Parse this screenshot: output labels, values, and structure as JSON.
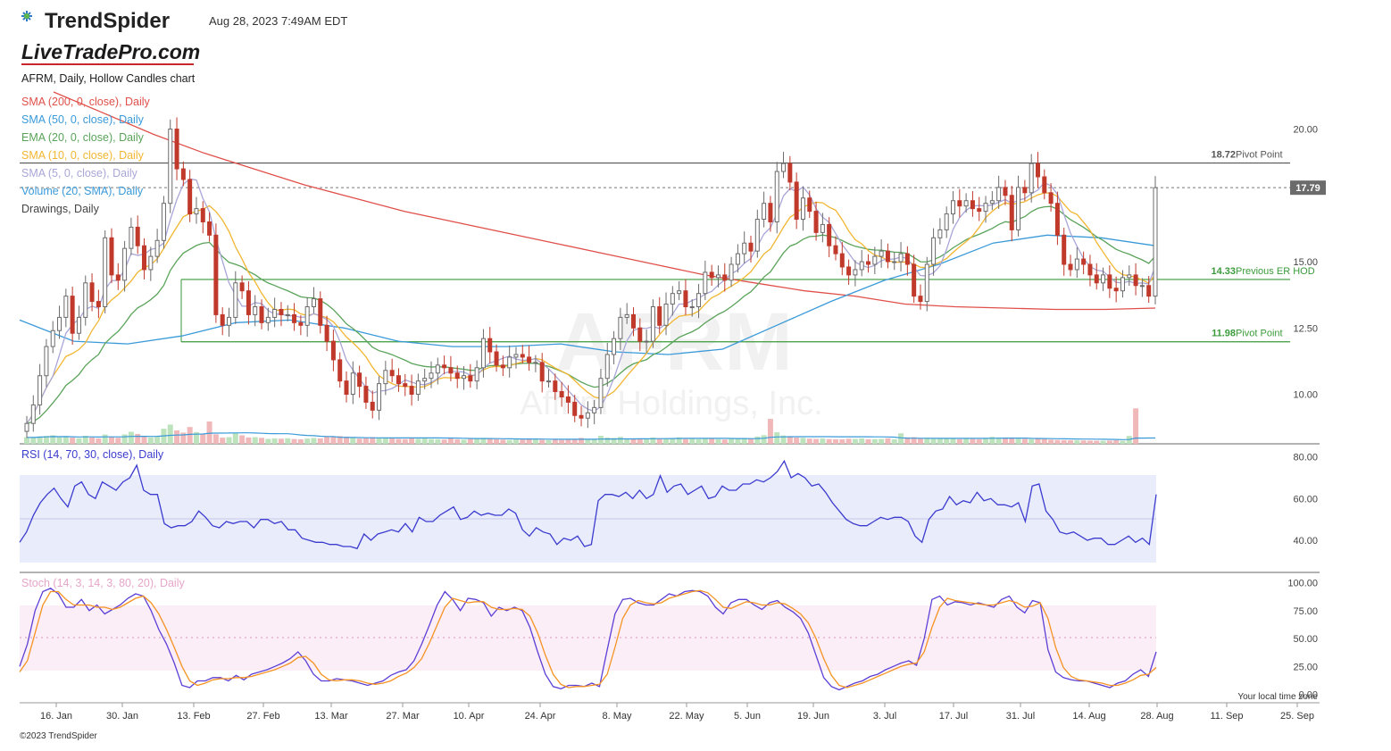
{
  "header": {
    "brand_name": "TrendSpider",
    "timestamp": "Aug 28, 2023 7:49AM EDT",
    "watermark_logo": "LiveTradePro.com",
    "footer": "©2023 TrendSpider",
    "tz_note": "Your local time zone"
  },
  "legend": {
    "title": "AFRM, Daily, Hollow Candles chart",
    "items": [
      {
        "label": "SMA (200, 0, close), Daily",
        "color": "#e0504a"
      },
      {
        "label": "SMA (50, 0, close), Daily",
        "color": "#3a9ad9"
      },
      {
        "label": "EMA (20, 0, close), Daily",
        "color": "#5aa35a"
      },
      {
        "label": "SMA (10, 0, close), Daily",
        "color": "#f2b632"
      },
      {
        "label": "SMA (5, 0, close), Daily",
        "color": "#a9a6d8"
      },
      {
        "label": "Volume (20, SMA), Daily",
        "color": "#3a9ad9"
      },
      {
        "label": "Drawings, Daily",
        "color": "#444444"
      }
    ]
  },
  "watermark": {
    "symbol": "AFRM",
    "company": "Affirm Holdings, Inc."
  },
  "chart_data": [
    {
      "type": "candlestick",
      "title": "AFRM, Daily, Hollow Candles chart",
      "ylim": [
        8.3,
        21.5
      ],
      "yticks": [
        20.0,
        15.0,
        12.5,
        10.0
      ],
      "ytick_labels": [
        "20.00",
        "15.00",
        "12.50",
        "10.00"
      ],
      "xticks": [
        "16. Jan",
        "30. Jan",
        "13. Feb",
        "27. Feb",
        "13. Mar",
        "27. Mar",
        "10. Apr",
        "24. Apr",
        "8. May",
        "22. May",
        "5. Jun",
        "19. Jun",
        "3. Jul",
        "17. Jul",
        "31. Jul",
        "14. Aug",
        "28. Aug",
        "11. Sep",
        "25. Sep"
      ],
      "last_price": "17.79",
      "levels": [
        {
          "value": 18.72,
          "value_label": "18.72",
          "text": "Pivot Point",
          "color": "#555555"
        },
        {
          "value": 14.33,
          "value_label": "14.33",
          "text": "Previous ER HOD",
          "color": "#3a9a3a"
        },
        {
          "value": 11.98,
          "value_label": "11.98",
          "text": "Pivot Point",
          "color": "#3a9a3a"
        }
      ],
      "close": [
        8.9,
        9.6,
        10.7,
        11.8,
        12.4,
        12.9,
        13.7,
        12.3,
        12.9,
        14.2,
        13.5,
        13.3,
        15.9,
        14.5,
        14.3,
        15.5,
        16.3,
        15.6,
        14.7,
        15.2,
        15.8,
        17.2,
        20.0,
        18.5,
        18.1,
        16.8,
        17.0,
        16.5,
        16.0,
        13.0,
        12.6,
        12.9,
        14.2,
        13.9,
        13.0,
        13.3,
        12.7,
        12.9,
        13.2,
        13.0,
        13.0,
        12.7,
        12.6,
        13.3,
        13.6,
        12.6,
        12.0,
        11.3,
        10.5,
        10.0,
        10.8,
        10.3,
        9.7,
        9.4,
        10.4,
        10.9,
        10.7,
        10.4,
        10.3,
        10.0,
        10.5,
        10.6,
        10.8,
        11.1,
        11.0,
        10.8,
        10.6,
        10.7,
        10.5,
        11.0,
        12.1,
        11.6,
        11.1,
        11.0,
        11.4,
        11.5,
        11.4,
        11.2,
        11.2,
        10.5,
        10.5,
        10.1,
        9.9,
        9.7,
        9.2,
        9.1,
        9.3,
        9.5,
        10.6,
        11.5,
        12.1,
        12.9,
        13.0,
        12.5,
        12.0,
        12.0,
        13.3,
        12.6,
        13.4,
        13.8,
        13.9,
        13.3,
        13.3,
        13.8,
        14.6,
        14.4,
        14.5,
        14.3,
        14.9,
        15.3,
        15.7,
        15.4,
        16.6,
        17.2,
        16.5,
        18.4,
        18.7,
        18.0,
        16.6,
        17.4,
        16.9,
        16.1,
        16.4,
        15.6,
        15.3,
        14.8,
        14.5,
        14.7,
        15.0,
        14.9,
        15.2,
        15.4,
        15.0,
        15.0,
        15.3,
        14.9,
        13.7,
        13.5,
        14.9,
        15.9,
        16.2,
        16.8,
        17.3,
        17.1,
        17.3,
        17.0,
        16.9,
        17.2,
        17.3,
        17.8,
        17.5,
        16.2,
        17.8,
        17.6,
        18.7,
        18.2,
        17.6,
        17.2,
        16.0,
        14.9,
        14.7,
        15.1,
        14.9,
        14.5,
        14.2,
        14.5,
        14.0,
        13.9,
        14.4,
        14.5,
        14.1,
        14.1,
        13.7,
        17.79
      ],
      "volume_ylim": [
        0,
        40
      ],
      "volume": [
        4.2,
        4.0,
        4.8,
        5.1,
        5.5,
        4.3,
        4.8,
        4.0,
        3.6,
        5.2,
        4.1,
        3.5,
        6.0,
        4.5,
        3.9,
        6.1,
        7.8,
        6.4,
        4.8,
        4.2,
        4.5,
        9.8,
        12.5,
        8.7,
        7.3,
        10.9,
        7.6,
        6.2,
        14.5,
        6.2,
        4.0,
        4.3,
        7.2,
        5.5,
        4.1,
        4.3,
        3.9,
        3.2,
        3.5,
        3.3,
        3.6,
        3.1,
        2.9,
        3.4,
        3.8,
        3.5,
        4.6,
        4.9,
        5.0,
        4.6,
        3.8,
        3.4,
        4.0,
        4.3,
        4.1,
        3.9,
        3.5,
        3.2,
        3.1,
        3.6,
        3.3,
        3.9,
        3.1,
        3.0,
        2.8,
        3.5,
        2.9,
        2.7,
        3.1,
        3.4,
        3.9,
        3.5,
        3.0,
        2.7,
        2.5,
        2.8,
        2.7,
        3.0,
        2.8,
        2.6,
        2.4,
        2.8,
        2.5,
        3.0,
        3.2,
        3.8,
        2.8,
        3.1,
        5.2,
        4.1,
        3.8,
        4.5,
        3.4,
        3.0,
        3.2,
        2.9,
        4.1,
        3.5,
        3.3,
        3.6,
        4.2,
        3.1,
        3.4,
        3.0,
        3.7,
        3.3,
        3.0,
        2.8,
        3.5,
        3.6,
        3.8,
        3.2,
        4.7,
        5.6,
        16.2,
        7.5,
        5.4,
        5.0,
        4.1,
        3.9,
        3.4,
        3.2,
        3.5,
        3.1,
        3.0,
        2.9,
        3.3,
        3.2,
        3.5,
        3.0,
        3.1,
        3.2,
        3.6,
        3.0,
        6.8,
        4.2,
        4.3,
        3.6,
        4.0,
        3.1,
        3.5,
        3.3,
        3.4,
        3.0,
        3.2,
        3.1,
        3.0,
        3.4,
        4.5,
        3.9,
        3.6,
        3.8,
        3.3,
        3.2,
        3.0,
        3.4,
        3.1,
        2.7,
        2.5,
        2.4,
        2.3,
        2.3,
        2.2,
        2.1,
        2.0,
        2.0,
        2.1,
        2.3,
        2.0,
        5.1,
        23.0
      ],
      "series": [
        {
          "name": "SMA (200, 0, close), Daily",
          "color": "#e0504a",
          "values": [
            21.4,
            20.6,
            19.8,
            19.1,
            18.5,
            17.9,
            17.4,
            16.9,
            16.5,
            16.1,
            15.7,
            15.3,
            14.9,
            14.5,
            14.2,
            13.9,
            13.7,
            13.4,
            13.3,
            13.25,
            13.2,
            13.2,
            13.25
          ]
        },
        {
          "name": "SMA (50, 0, close), Daily",
          "color": "#3a9ad9",
          "values": [
            12.8,
            12.0,
            11.9,
            12.2,
            12.7,
            12.8,
            12.5,
            12.0,
            11.8,
            11.8,
            11.9,
            11.6,
            11.5,
            11.7,
            12.6,
            13.5,
            14.3,
            14.9,
            15.7,
            16.0,
            15.9,
            15.6
          ]
        }
      ],
      "grid": true
    },
    {
      "type": "line",
      "title": "RSI (14, 70, 30, close), Daily",
      "ylim": [
        28,
        82
      ],
      "yticks": [
        80,
        60,
        40
      ],
      "ytick_labels": [
        "80.00",
        "60.00",
        "40.00"
      ],
      "band": [
        30,
        70
      ],
      "series": [
        {
          "name": "RSI (14, 70, 30, close), Daily",
          "color": "#3b3bcf",
          "values": [
            39,
            44,
            52,
            58,
            62,
            65,
            60,
            56,
            66,
            68,
            62,
            60,
            68,
            66,
            64,
            68,
            70,
            76,
            64,
            62,
            62,
            48,
            46,
            47,
            47,
            49,
            54,
            51,
            47,
            46,
            49,
            48,
            49,
            49,
            46,
            50,
            50,
            48,
            49,
            45,
            45,
            41,
            40,
            39,
            39,
            38,
            38,
            37,
            37,
            36,
            43,
            40,
            43,
            44,
            45,
            44,
            48,
            44,
            51,
            49,
            49,
            52,
            54,
            56,
            50,
            51,
            54,
            52,
            53,
            52,
            52,
            55,
            53,
            45,
            42,
            46,
            44,
            43,
            38,
            41,
            40,
            42,
            37,
            38,
            59,
            62,
            62,
            61,
            63,
            60,
            64,
            60,
            62,
            71,
            63,
            66,
            67,
            62,
            64,
            66,
            60,
            61,
            66,
            64,
            64,
            67,
            67,
            69,
            68,
            70,
            73,
            78,
            70,
            72,
            70,
            66,
            67,
            63,
            58,
            54,
            50,
            48,
            47,
            47,
            49,
            51,
            50,
            51,
            51,
            49,
            42,
            39,
            50,
            54,
            55,
            61,
            57,
            59,
            58,
            63,
            59,
            60,
            57,
            57,
            56,
            58,
            49,
            66,
            67,
            54,
            50,
            44,
            43,
            44,
            42,
            40,
            41,
            41,
            38,
            38,
            40,
            42,
            39,
            41,
            38,
            62
          ]
        }
      ]
    },
    {
      "type": "line",
      "title": "Stoch (14, 3, 14, 3, 80, 20), Daily",
      "ylim": [
        -2,
        102
      ],
      "yticks": [
        100,
        75,
        50,
        25,
        0
      ],
      "ytick_labels": [
        "100.00",
        "75.00",
        "50.00",
        "25.00",
        "0.00"
      ],
      "band": [
        20,
        80
      ],
      "midline": 50,
      "series": [
        {
          "name": "%K",
          "color": "#5c3fd6",
          "values": [
            25,
            45,
            75,
            92,
            95,
            90,
            78,
            78,
            85,
            75,
            80,
            72,
            76,
            80,
            86,
            90,
            88,
            75,
            58,
            45,
            28,
            8,
            6,
            12,
            12,
            15,
            15,
            12,
            17,
            13,
            18,
            20,
            22,
            25,
            28,
            32,
            38,
            30,
            18,
            12,
            12,
            14,
            13,
            12,
            10,
            8,
            10,
            12,
            17,
            20,
            22,
            30,
            45,
            62,
            80,
            92,
            85,
            75,
            86,
            85,
            82,
            70,
            78,
            75,
            78,
            75,
            60,
            38,
            18,
            7,
            5,
            8,
            8,
            7,
            10,
            7,
            40,
            72,
            85,
            86,
            82,
            80,
            80,
            85,
            90,
            88,
            92,
            93,
            92,
            88,
            78,
            72,
            82,
            85,
            85,
            80,
            76,
            82,
            84,
            78,
            74,
            68,
            55,
            35,
            15,
            7,
            4,
            7,
            10,
            12,
            16,
            18,
            22,
            25,
            28,
            30,
            26,
            50,
            85,
            88,
            80,
            83,
            82,
            80,
            82,
            80,
            78,
            85,
            88,
            78,
            73,
            84,
            82,
            40,
            20,
            15,
            13,
            12,
            12,
            10,
            8,
            6,
            10,
            12,
            18,
            22,
            16,
            38
          ]
        },
        {
          "name": "%D",
          "color": "#f59323",
          "values": [
            20,
            30,
            55,
            80,
            92,
            92,
            85,
            80,
            80,
            80,
            78,
            78,
            76,
            78,
            82,
            86,
            88,
            82,
            72,
            58,
            42,
            25,
            12,
            8,
            10,
            13,
            14,
            14,
            15,
            15,
            16,
            18,
            20,
            22,
            25,
            28,
            33,
            34,
            28,
            18,
            13,
            12,
            13,
            13,
            12,
            10,
            9,
            10,
            12,
            16,
            19,
            24,
            32,
            46,
            62,
            78,
            86,
            84,
            82,
            83,
            83,
            78,
            76,
            76,
            77,
            76,
            70,
            55,
            35,
            18,
            9,
            6,
            7,
            7,
            8,
            9,
            18,
            42,
            68,
            80,
            84,
            82,
            81,
            82,
            86,
            88,
            90,
            92,
            93,
            91,
            85,
            78,
            77,
            80,
            83,
            82,
            80,
            80,
            82,
            81,
            77,
            72,
            64,
            50,
            32,
            17,
            8,
            6,
            8,
            10,
            13,
            16,
            19,
            22,
            25,
            27,
            28,
            38,
            60,
            78,
            86,
            84,
            83,
            82,
            81,
            80,
            80,
            82,
            84,
            82,
            78,
            79,
            82,
            68,
            42,
            24,
            16,
            13,
            12,
            11,
            10,
            8,
            8,
            10,
            13,
            17,
            18,
            24
          ]
        }
      ]
    }
  ]
}
